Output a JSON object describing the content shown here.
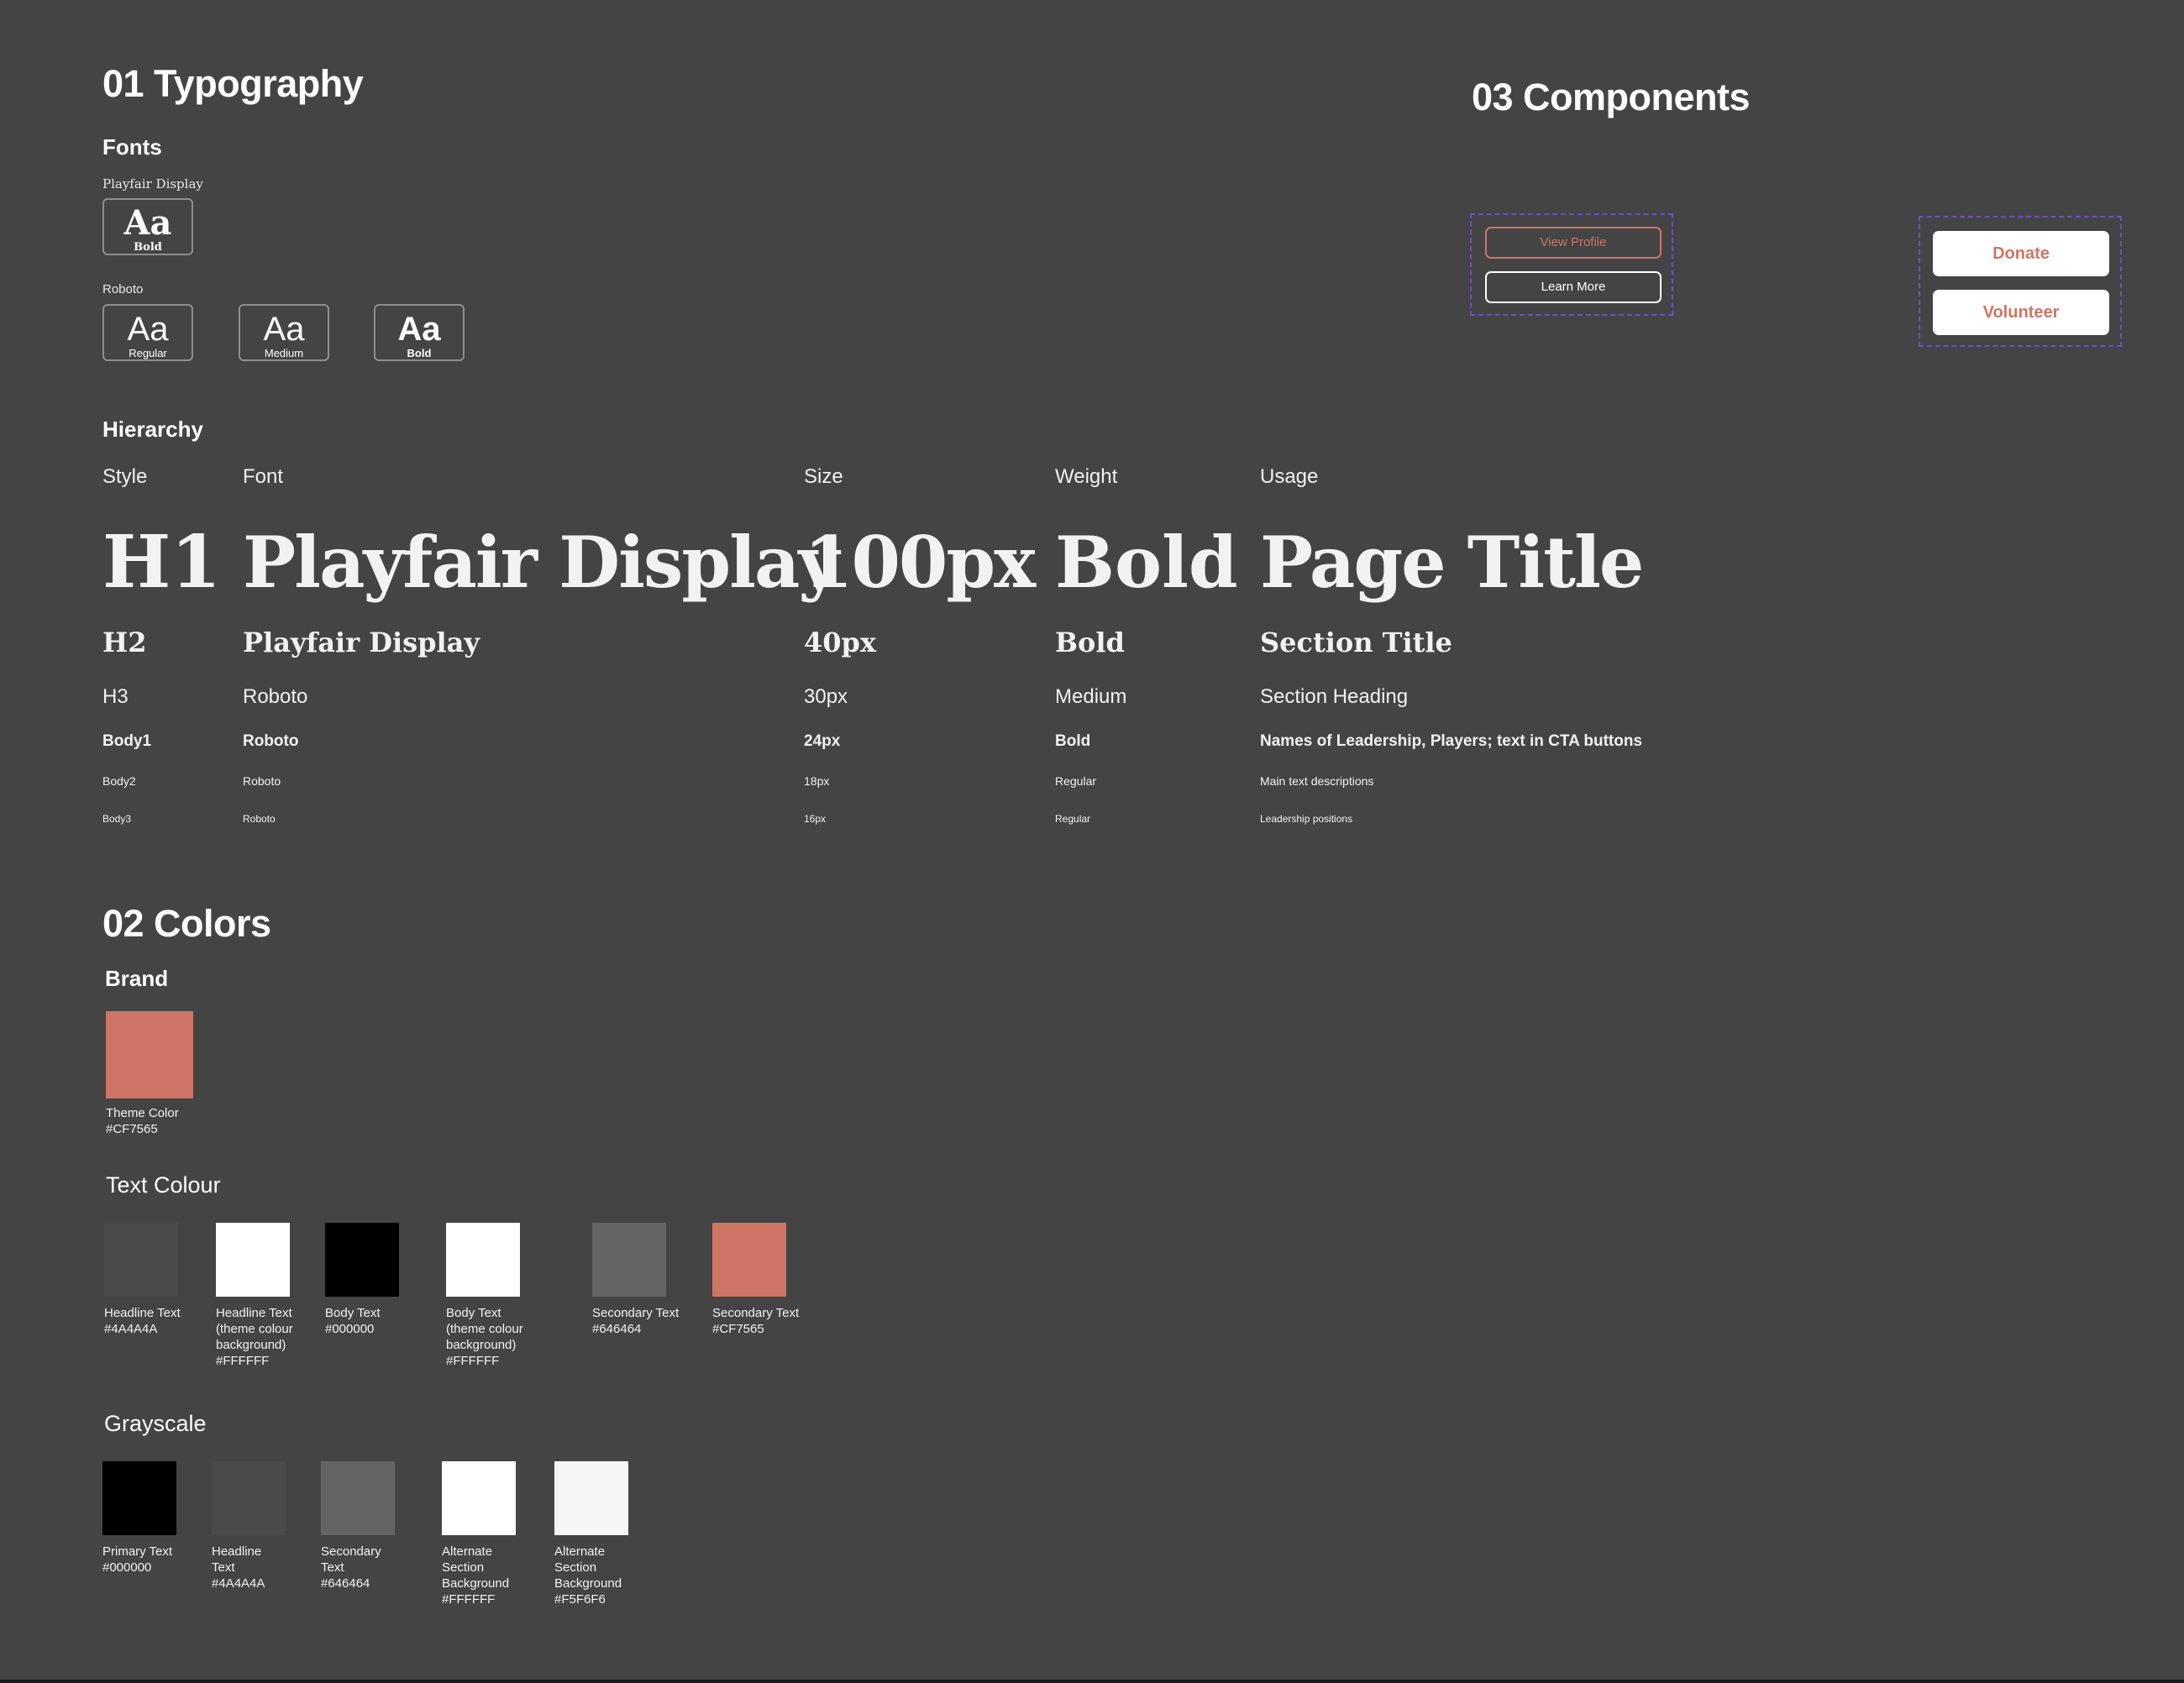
{
  "typography": {
    "title": "01 Typography",
    "fonts_heading": "Fonts",
    "playfair": {
      "name": "Playfair Display",
      "tiles": [
        {
          "glyph": "Aa",
          "weight": "Bold"
        }
      ]
    },
    "roboto": {
      "name": "Roboto",
      "tiles": [
        {
          "glyph": "Aa",
          "weight": "Regular"
        },
        {
          "glyph": "Aa",
          "weight": "Medium"
        },
        {
          "glyph": "Aa",
          "weight": "Bold"
        }
      ]
    },
    "hierarchy_heading": "Hierarchy",
    "columns": [
      "Style",
      "Font",
      "Size",
      "Weight",
      "Usage"
    ],
    "rows": [
      {
        "style": "H1",
        "font": "Playfair Display",
        "size": "100px",
        "weight": "Bold",
        "usage": "Page Title"
      },
      {
        "style": "H2",
        "font": "Playfair Display",
        "size": "40px",
        "weight": "Bold",
        "usage": "Section Title"
      },
      {
        "style": "H3",
        "font": "Roboto",
        "size": "30px",
        "weight": "Medium",
        "usage": "Section Heading"
      },
      {
        "style": "Body1",
        "font": "Roboto",
        "size": "24px",
        "weight": "Bold",
        "usage": "Names of Leadership, Players; text in CTA buttons"
      },
      {
        "style": "Body2",
        "font": "Roboto",
        "size": "18px",
        "weight": "Regular",
        "usage": "Main text descriptions"
      },
      {
        "style": "Body3",
        "font": "Roboto",
        "size": "16px",
        "weight": "Regular",
        "usage": "Leadership positions"
      }
    ]
  },
  "colors": {
    "title": "02 Colors",
    "brand_heading": "Brand",
    "brand": [
      {
        "name": "Theme Color",
        "hex": "#CF7565"
      }
    ],
    "text_heading": "Text Colour",
    "text": [
      {
        "lines": [
          "Headline Text",
          "#4A4A4A"
        ],
        "hex": "#4A4A4A"
      },
      {
        "lines": [
          "Headline Text",
          "(theme colour",
          "background)",
          "#FFFFFF"
        ],
        "hex": "#FFFFFF"
      },
      {
        "lines": [
          "Body Text",
          "#000000"
        ],
        "hex": "#000000"
      },
      {
        "lines": [
          "Body Text",
          "(theme colour",
          "background)",
          "#FFFFFF"
        ],
        "hex": "#FFFFFF"
      },
      {
        "lines": [
          "Secondary Text",
          "#646464"
        ],
        "hex": "#646464"
      },
      {
        "lines": [
          "Secondary Text",
          "#CF7565"
        ],
        "hex": "#CF7565"
      }
    ],
    "grayscale_heading": "Grayscale",
    "grayscale": [
      {
        "lines": [
          "Primary Text",
          "#000000"
        ],
        "hex": "#000000"
      },
      {
        "lines": [
          "Headline",
          "Text",
          "#4A4A4A"
        ],
        "hex": "#4A4A4A"
      },
      {
        "lines": [
          "Secondary",
          "Text",
          "#646464"
        ],
        "hex": "#646464"
      },
      {
        "lines": [
          "Alternate",
          "Section",
          "Background",
          "#FFFFFF"
        ],
        "hex": "#FFFFFF"
      },
      {
        "lines": [
          "Alternate",
          "Section",
          "Background",
          "#F5F6F6"
        ],
        "hex": "#F5F6F6"
      }
    ]
  },
  "components": {
    "title": "03 Components",
    "outline_buttons": {
      "view_profile": "View Profile",
      "learn_more": "Learn More"
    },
    "solid_buttons": {
      "donate": "Donate",
      "volunteer": "Volunteer"
    },
    "accent": "#CF7565",
    "dash_color": "#6B4FC4"
  }
}
